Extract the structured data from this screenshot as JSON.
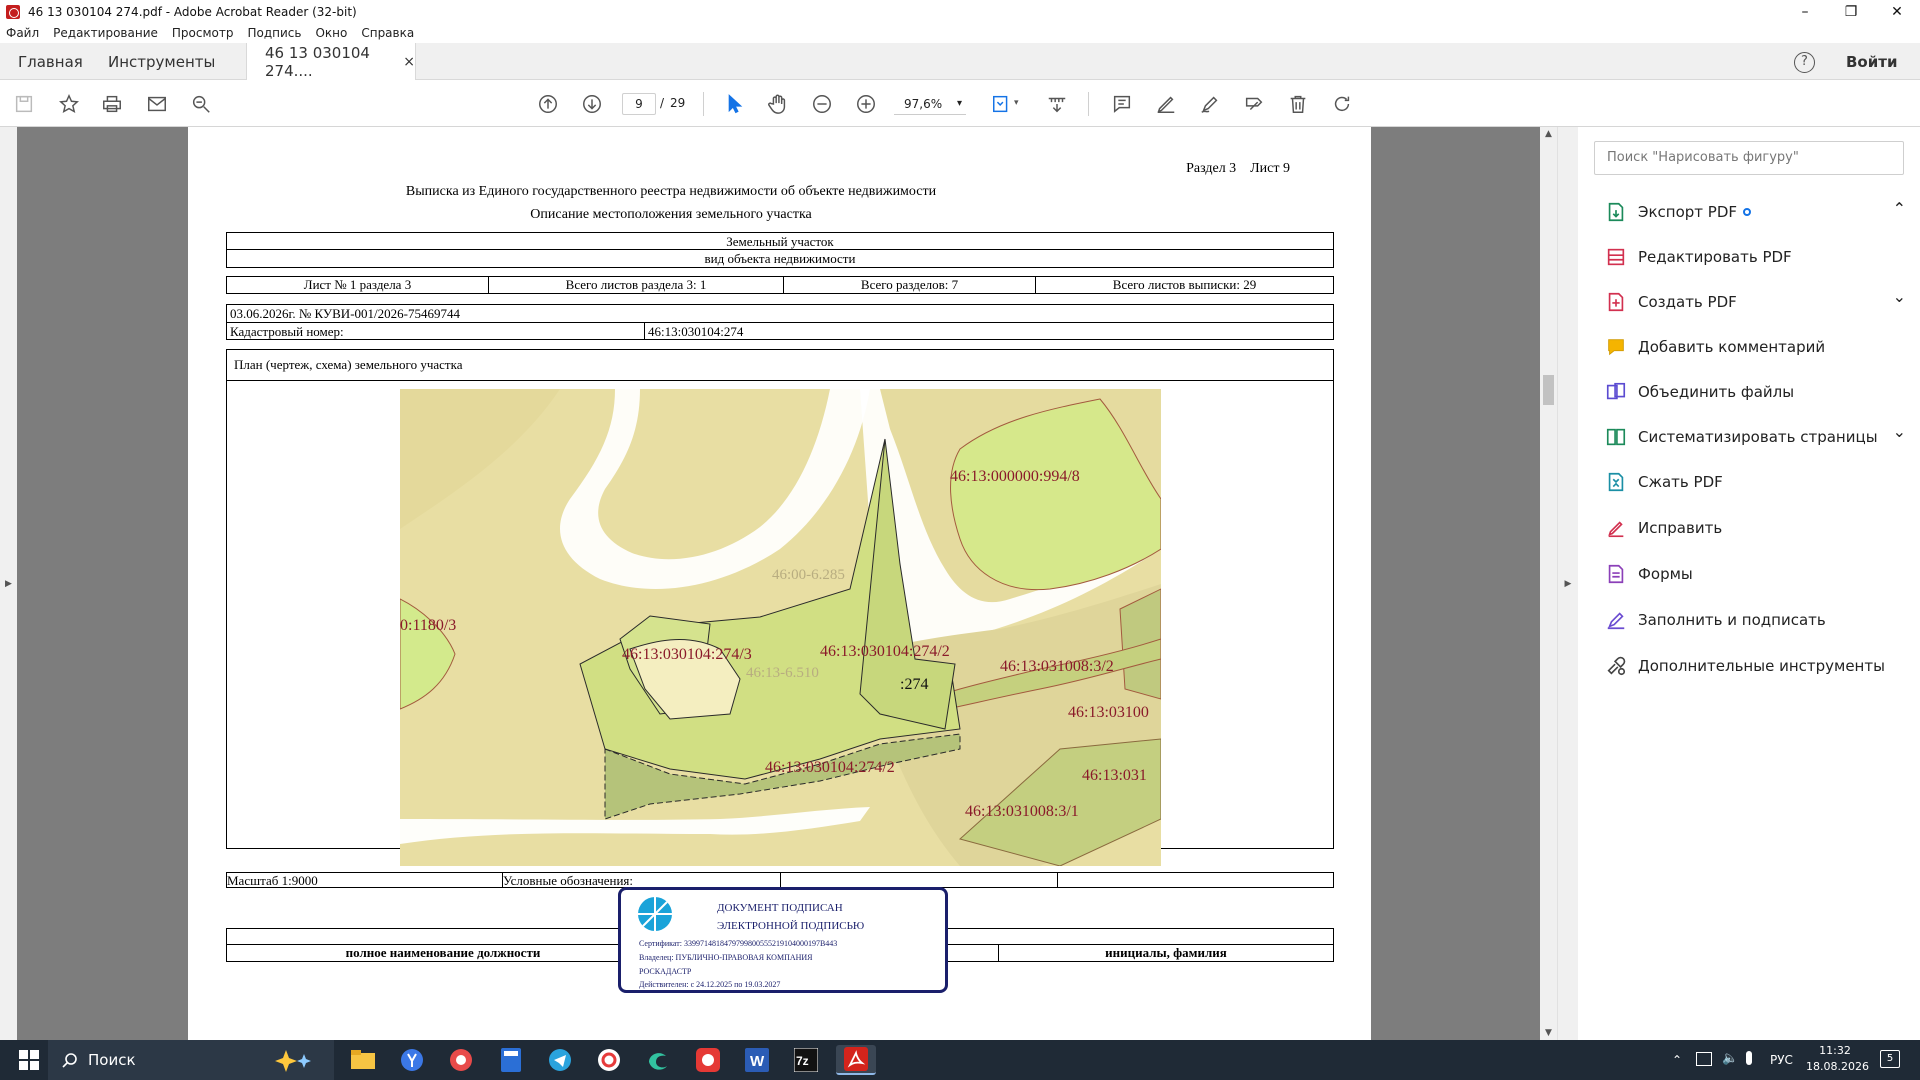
{
  "window": {
    "title": "46 13 030104 274.pdf - Adobe Acrobat Reader (32-bit)",
    "minimize": "–",
    "restore": "❐",
    "close": "✕"
  },
  "menu": [
    "Файл",
    "Редактирование",
    "Просмотр",
    "Подпись",
    "Окно",
    "Справка"
  ],
  "tabs": {
    "home": "Главная",
    "tools": "Инструменты",
    "doc": "46 13 030104 274....",
    "close": "×",
    "help": "?",
    "signin": "Войти"
  },
  "toolbar": {
    "page_current": "9",
    "page_sep": "/",
    "page_total": "29",
    "zoom": "97,6%",
    "zoom_arrow": "▾",
    "fit_arrow": "▾"
  },
  "doc": {
    "header_right": "Раздел 3    Лист 9",
    "title1": "Выписка из Единого государственного реестра недвижимости об объекте недвижимости",
    "title2": "Описание местоположения земельного участка",
    "object_type": "Земельный участок",
    "object_type_caption": "вид объекта недвижимости",
    "row_sheet": "Лист № 1 раздела 3",
    "row_total_sheets_sec": "Всего листов раздела 3: 1",
    "row_total_sections": "Всего разделов: 7",
    "row_total_sheets": "Всего листов выписки: 29",
    "date_num": "03.06.2026г. № КУВИ-001/2026-75469744",
    "cad_label": "Кадастровый номер:",
    "cad_value": "46:13:030104:274",
    "plan_title": "План (чертеж, схема) земельного участка",
    "scale": "Масштаб 1:9000",
    "legend": "Условные обозначения:",
    "position_caption": "полное наименование должности",
    "name_caption": "инициалы, фамилия"
  },
  "map_labels": {
    "l1": "46:13:000000:994/8",
    "l2": "46:00-6.285",
    "l3": "0:1180/3",
    "l4": "46:13:030104:274/3",
    "l5": "46:13-6.510",
    "l6": "46:13:030104:274/2",
    "l7": ":274",
    "l8": "46:13:031008:3/2",
    "l9": "46:13:03100",
    "l10": "46:13:030104:274/2",
    "l11": "46:13:031",
    "l12": "46:13:031008:3/1"
  },
  "stamp": {
    "line1": "ДОКУМЕНТ ПОДПИСАН",
    "line2": "ЭЛЕКТРОННОЙ ПОДПИСЬЮ",
    "cert": "Сертификат: 3399714818479799800555219104000197B443",
    "owner": "Владелец: ПУБЛИЧНО-ПРАВОВАЯ КОМПАНИЯ",
    "owner2": "РОСКАДАСТР",
    "valid": "Действителен: с 24.12.2025 по 19.03.2027"
  },
  "panel": {
    "search_placeholder": "Поиск \"Нарисовать фигуру\"",
    "items": [
      "Экспорт PDF",
      "Редактировать PDF",
      "Создать PDF",
      "Добавить комментарий",
      "Объединить файлы",
      "Систематизировать страницы",
      "Сжать PDF",
      "Исправить",
      "Формы",
      "Заполнить и подписать",
      "Дополнительные инструменты"
    ],
    "chev_up": "⌃",
    "chev_down": "⌄"
  },
  "taskbar": {
    "search": "Поиск",
    "lang": "РУС",
    "time": "11:32",
    "date": "18.08.2026",
    "notif": "5"
  },
  "colors": {
    "accent": "#1473e6",
    "red": "#c8102e",
    "map_bg": "#e8dea3",
    "stamp_border": "#1a1f6b"
  }
}
